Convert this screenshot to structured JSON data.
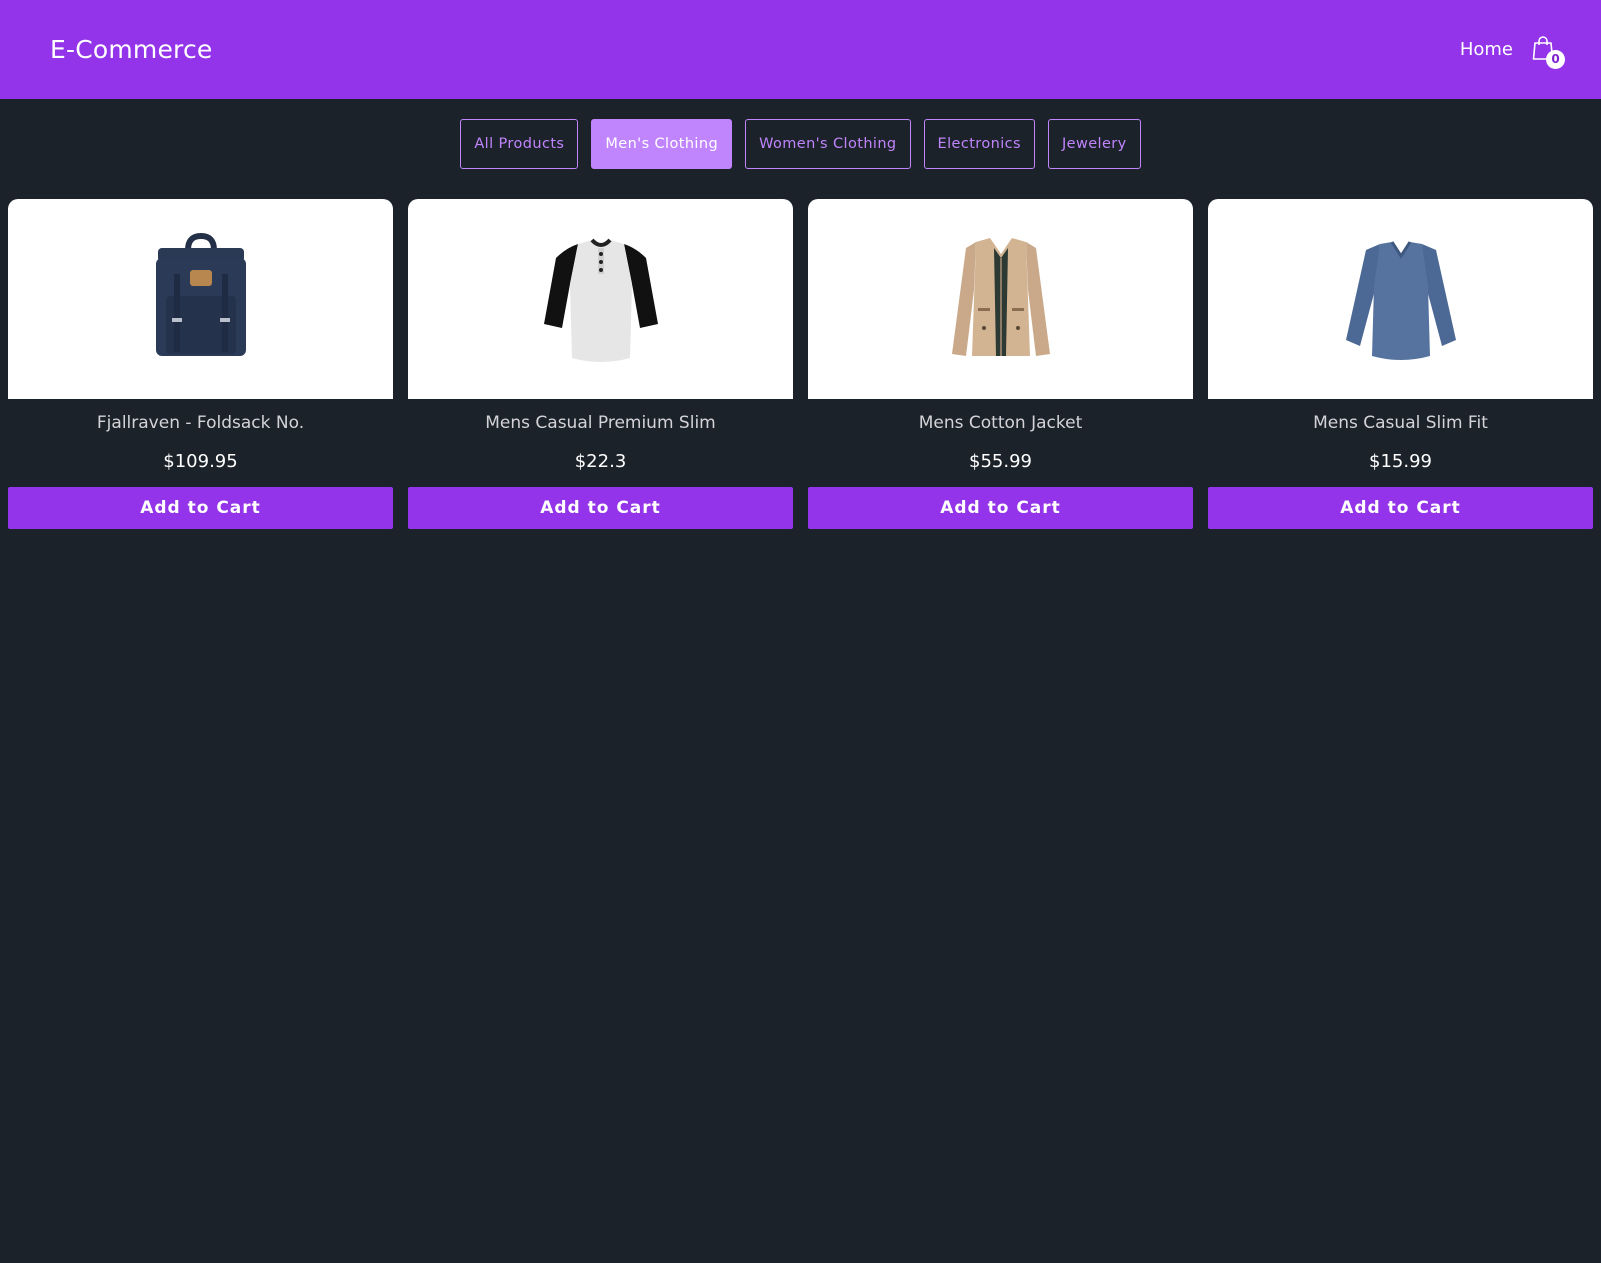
{
  "navbar": {
    "brand": "E-Commerce",
    "home_label": "Home",
    "cart_icon": "shopping-bag-icon",
    "cart_count": "0"
  },
  "filters": [
    {
      "label": "All Products",
      "active": false
    },
    {
      "label": "Men's Clothing",
      "active": true
    },
    {
      "label": "Women's Clothing",
      "active": false
    },
    {
      "label": "Electronics",
      "active": false
    },
    {
      "label": "Jewelery",
      "active": false
    }
  ],
  "products": [
    {
      "title": "Fjallraven - Foldsack No.",
      "price": "$109.95",
      "button_label": "Add to Cart",
      "image": "navy-backpack"
    },
    {
      "title": "Mens Casual Premium Slim",
      "price": "$22.3",
      "button_label": "Add to Cart",
      "image": "raglan-henley-tshirt"
    },
    {
      "title": "Mens Cotton Jacket",
      "price": "$55.99",
      "button_label": "Add to Cart",
      "image": "khaki-cotton-jacket"
    },
    {
      "title": "Mens Casual Slim Fit",
      "price": "$15.99",
      "button_label": "Add to Cart",
      "image": "blue-long-sleeve-shirt"
    }
  ],
  "colors": {
    "brand": "#9333ea",
    "accent": "#c084fc",
    "background": "#1c222a"
  }
}
